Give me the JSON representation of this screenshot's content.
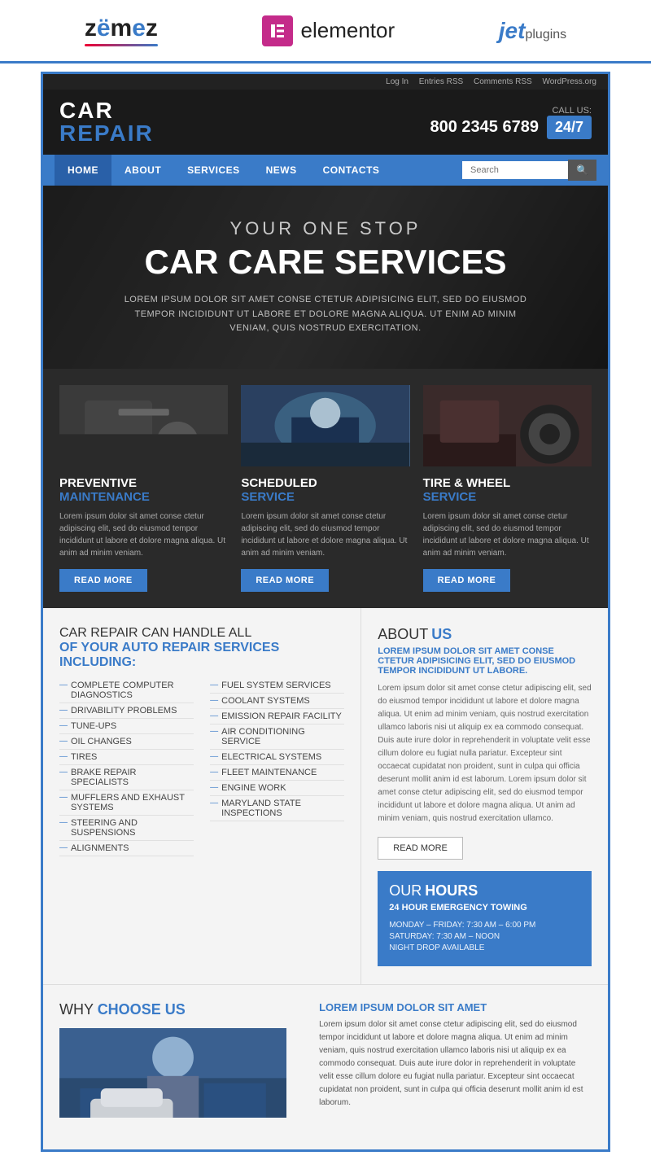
{
  "logos": {
    "zemes": "ZEMEz",
    "elementor": "elementor",
    "jet": "JET",
    "plugins": "plugins"
  },
  "utility_bar": {
    "items": [
      "Log In",
      "Entries RSS",
      "Comments RSS",
      "WordPress.org"
    ]
  },
  "header": {
    "logo_car": "CAR",
    "logo_repair": "REPAIR",
    "call_label": "CALL US:",
    "phone": "800 2345 6789",
    "badge": "24/7"
  },
  "nav": {
    "items": [
      "HOME",
      "ABOUT",
      "SERVICES",
      "NEWS",
      "CONTACTS"
    ],
    "search_placeholder": "Search"
  },
  "hero": {
    "sub": "YOUR ONE STOP",
    "title": "CAR CARE SERVICES",
    "text": "LOREM IPSUM DOLOR SIT AMET CONSE CTETUR ADIPISICING ELIT, SED DO EIUSMOD TEMPOR INCIDIDUNT UT LABORE ET DOLORE MAGNA ALIQUA. UT ENIM AD MINIM VENIAM, QUIS NOSTRUD EXERCITATION."
  },
  "services": [
    {
      "title_main": "PREVENTIVE",
      "title_blue": "MAINTENANCE",
      "desc": "Lorem ipsum dolor sit amet conse ctetur adipiscing elit, sed do eiusmod tempor incididunt ut labore et dolore magna aliqua. Ut anim ad minim veniam.",
      "btn": "READ MORE"
    },
    {
      "title_main": "SCHEDULED",
      "title_blue": "SERVICE",
      "desc": "Lorem ipsum dolor sit amet conse ctetur adipiscing elit, sed do eiusmod tempor incididunt ut labore et dolore magna aliqua. Ut anim ad minim veniam.",
      "btn": "READ MORE"
    },
    {
      "title_main": "TIRE & WHEEL",
      "title_blue": "SERVICE",
      "desc": "Lorem ipsum dolor sit amet conse ctetur adipiscing elit, sed do eiusmod tempor incididunt ut labore et dolore magna aliqua. Ut anim ad minim veniam.",
      "btn": "READ MORE"
    }
  ],
  "can_handle": {
    "heading1": "CAR REPAIR CAN HANDLE ALL",
    "heading2": "OF YOUR AUTO REPAIR SERVICES INCLUDING:",
    "col1": [
      "COMPLETE COMPUTER DIAGNOSTICS",
      "DRIVABILITY PROBLEMS",
      "TUNE-UPS",
      "OIL CHANGES",
      "TIRES",
      "BRAKE REPAIR SPECIALISTS",
      "MUFFLERS AND EXHAUST SYSTEMS",
      "STEERING AND SUSPENSIONS",
      "ALIGNMENTS"
    ],
    "col2": [
      "FUEL SYSTEM SERVICES",
      "COOLANT SYSTEMS",
      "EMISSION REPAIR FACILITY",
      "AIR CONDITIONING SERVICE",
      "ELECTRICAL SYSTEMS",
      "FLEET MAINTENANCE",
      "ENGINE WORK",
      "MARYLAND STATE INSPECTIONS"
    ]
  },
  "about": {
    "heading": "ABOUT",
    "heading_strong": "US",
    "subtext": "LOREM IPSUM DOLOR SIT AMET CONSE CTETUR ADIPISICING ELIT, SED DO EIUSMOD TEMPOR INCIDIDUNT UT LABORE.",
    "desc": "Lorem ipsum dolor sit amet conse ctetur adipiscing elit, sed do eiusmod tempor incididunt ut labore et dolore magna aliqua. Ut enim ad minim veniam, quis nostrud exercitation ullamco laboris nisi ut aliquip ex ea commodo consequat. Duis aute irure dolor in reprehenderit in voluptate velit esse cillum dolore eu fugiat nulla pariatur. Excepteur sint occaecat cupidatat non proident, sunt in culpa qui officia deserunt mollit anim id est laborum. Lorem ipsum dolor sit amet conse ctetur adipiscing elit, sed do eiusmod tempor incididunt ut labore et dolore magna aliqua. Ut anim ad minim veniam, quis nostrud exercitation ullamco.",
    "btn": "READ MORE"
  },
  "why": {
    "heading": "WHY",
    "heading_strong": "CHOOSE US",
    "sub_title": "LOREM IPSUM DOLOR SIT AMET",
    "text": "Lorem ipsum dolor sit amet conse ctetur adipiscing elit, sed do eiusmod tempor incididunt ut labore et dolore magna aliqua. Ut enim ad minim veniam, quis nostrud exercitation ullamco laboris nisi ut aliquip ex ea commodo consequat. Duis aute irure dolor in reprehenderit in voluptate velit esse cillum dolore eu fugiat nulla pariatur. Excepteur sint occaecat cupidatat non proident, sunt in culpa qui officia deserunt mollit anim id est laborum."
  },
  "hours": {
    "heading": "OUR",
    "heading_strong": "HOURS",
    "emerg": "24 HOUR EMERGENCY TOWING",
    "rows": [
      "MONDAY – FRIDAY: 7:30 AM – 6:00 PM",
      "SATURDAY: 7:30 AM – NOON",
      "NIGHT DROP AVAILABLE"
    ]
  }
}
